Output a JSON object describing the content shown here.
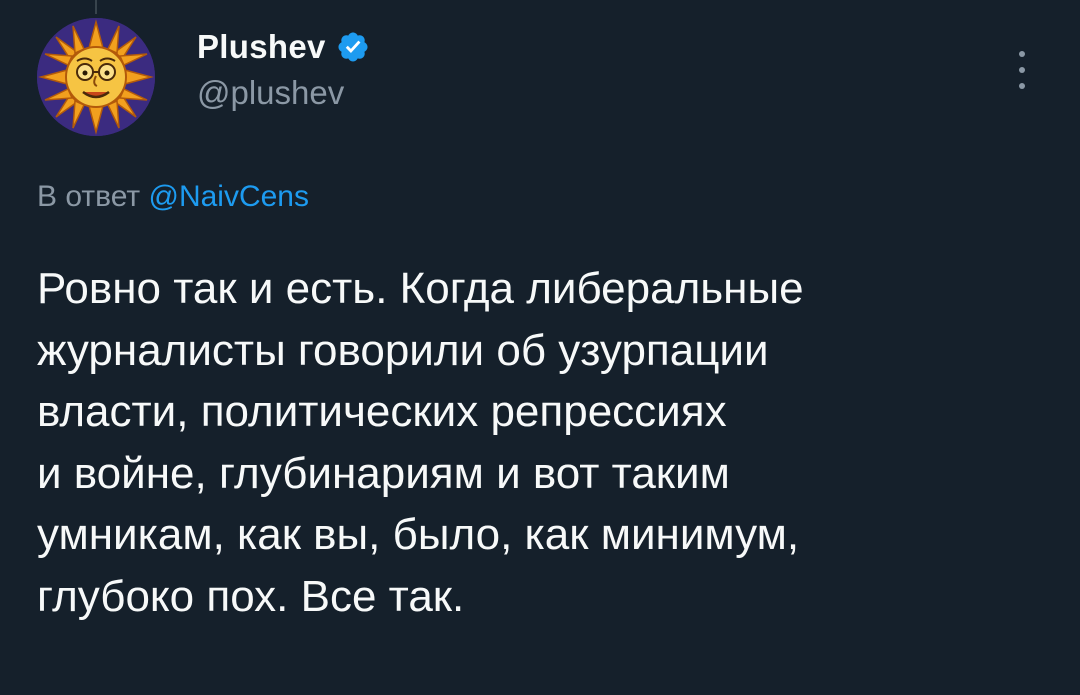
{
  "tweet": {
    "author": {
      "display_name": "Plushev",
      "handle": "@plushev",
      "verified": true,
      "avatar_icon": "sun-face-avatar"
    },
    "reply_to": {
      "prefix": "В ответ",
      "mention": "@NaivCens"
    },
    "text": "Ровно так и есть. Когда либеральные\nжурналисты говорили об узурпации\nвласти, политических репрессиях\nи войне, глубинариям и вот таким\nумникам, как вы, было, как минимум,\nглубоко пох. Все так."
  },
  "colors": {
    "background": "#15202b",
    "text": "#f7f9f9",
    "secondary_text": "#8b98a5",
    "accent": "#1d9bf0"
  }
}
